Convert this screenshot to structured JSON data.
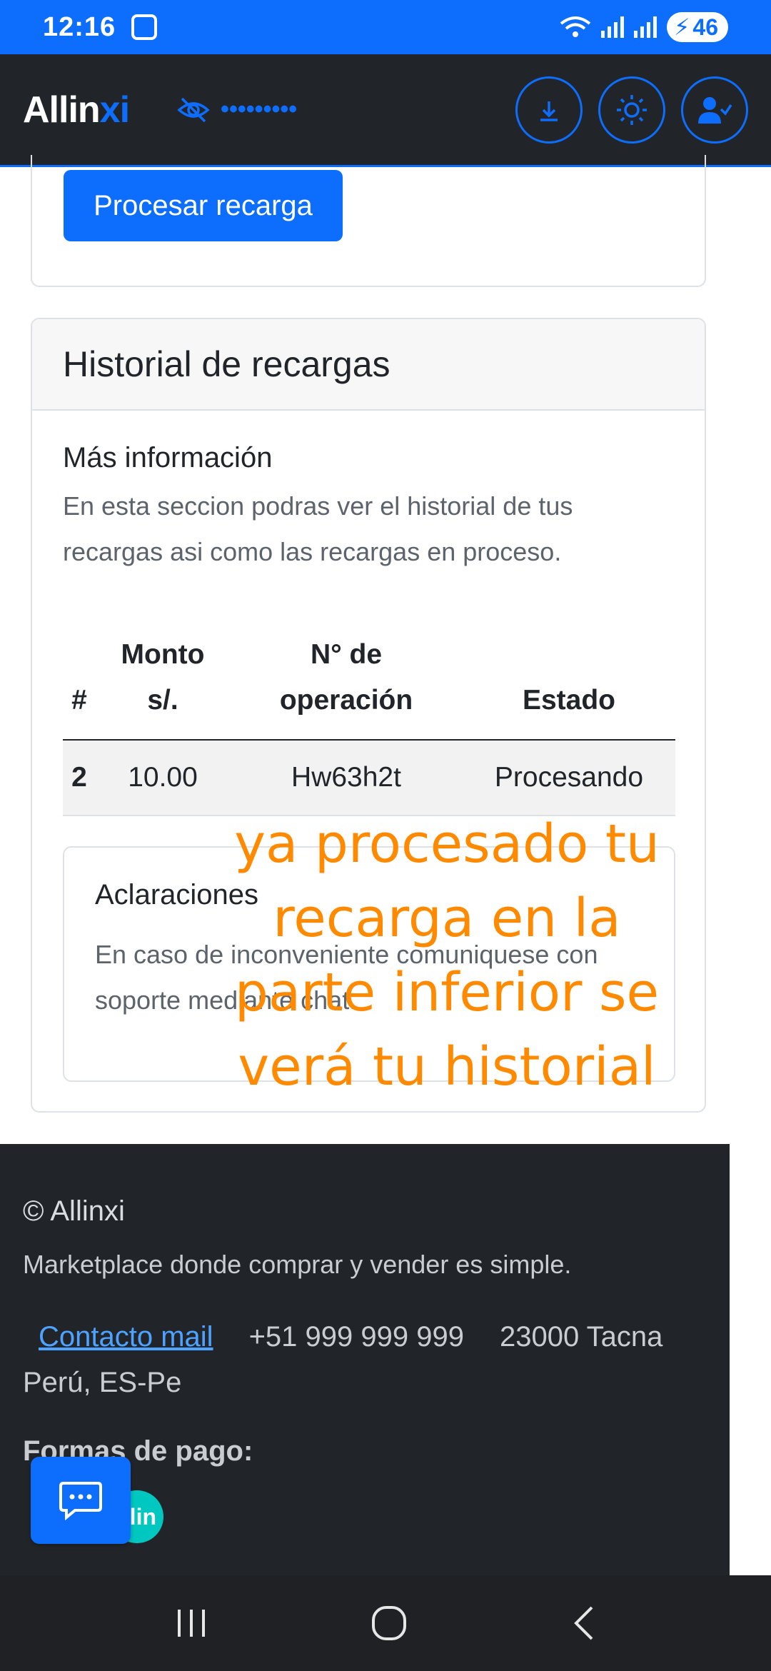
{
  "status_bar": {
    "time": "12:16",
    "battery": "46"
  },
  "navbar": {
    "brand_main": "Allin",
    "brand_accent": "xi",
    "balance_mask": "•••••••••"
  },
  "recharge": {
    "submit_label": "Procesar recarga"
  },
  "history": {
    "title": "Historial de recargas",
    "info_title": "Más información",
    "info_text": "En esta seccion podras ver el historial de tus recargas asi como las recargas en proceso.",
    "columns": [
      "#",
      "Monto s/.",
      "N° de operación",
      "Estado"
    ],
    "rows": [
      {
        "id": "2",
        "amount": "10.00",
        "operation": "Hw63h2t",
        "status": "Procesando"
      }
    ],
    "clarifications_title": "Aclaraciones",
    "clarifications_text": "En caso de inconveniente comuniquese con soporte mediante chat."
  },
  "annotation": {
    "text": "ya procesado tu recarga en la parte inferior se verá tu historial",
    "color": "#ff8a00"
  },
  "footer": {
    "copyright": "© Allinxi",
    "tagline": "Marketplace donde comprar y vender es simple.",
    "contact_link": "Contacto mail",
    "phone": "+51 999 999 999",
    "address": "23000 Tacna Perú, ES-Pe",
    "payments_title": "Formas de pago:",
    "payment_partial_label": "lin"
  },
  "colors": {
    "primary": "#0d6efd",
    "dark": "#212529"
  }
}
